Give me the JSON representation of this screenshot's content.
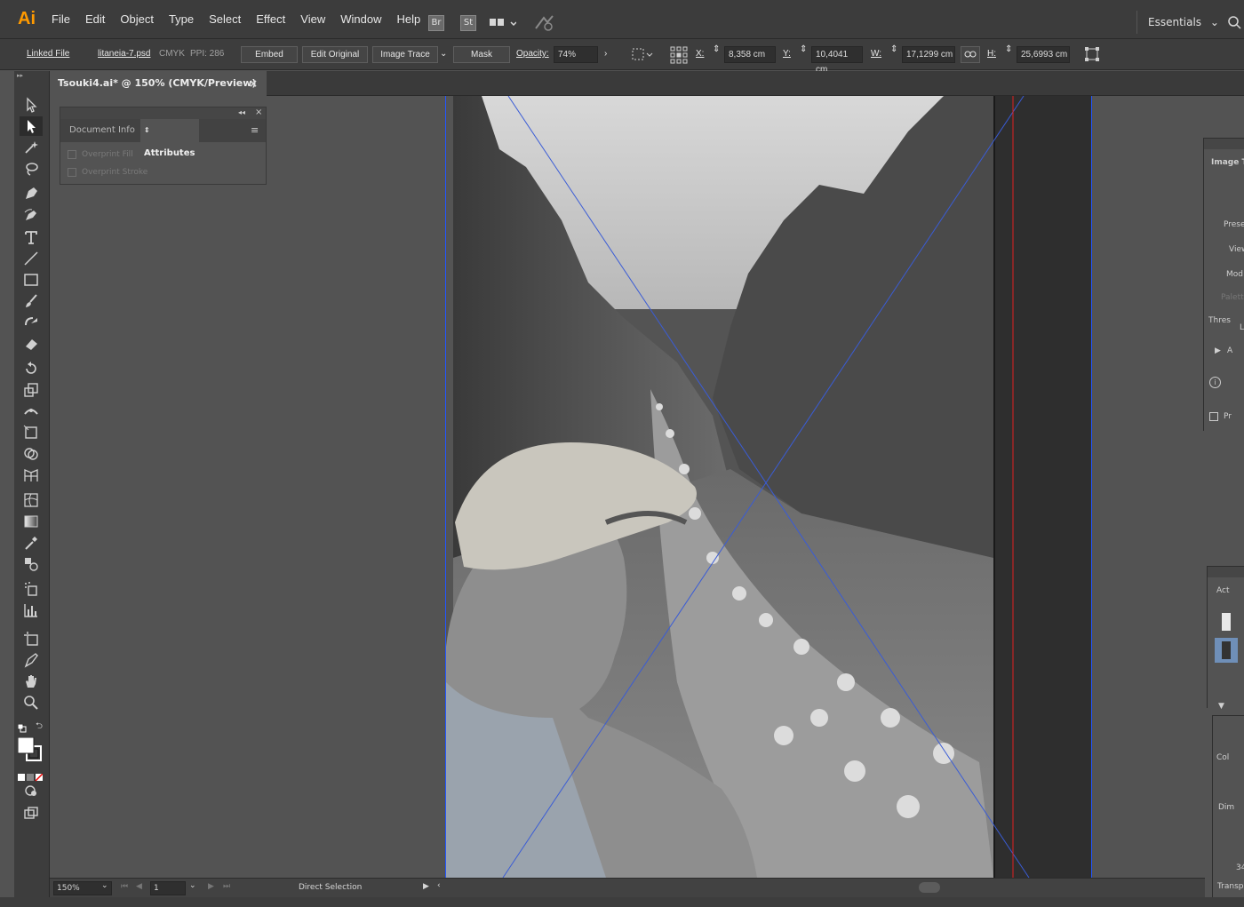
{
  "app": {
    "logo": "Ai",
    "menu": [
      "File",
      "Edit",
      "Object",
      "Type",
      "Select",
      "Effect",
      "View",
      "Window",
      "Help"
    ],
    "bridge_label": "Br",
    "stock_label": "St",
    "workspace": "Essentials"
  },
  "control_bar": {
    "linked_file": "Linked File",
    "file_name": "litaneia-7.psd",
    "color_mode": "CMYK",
    "ppi": "PPI: 286",
    "embed": "Embed",
    "edit_original": "Edit Original",
    "image_trace": "Image Trace",
    "mask": "Mask",
    "opacity_label": "Opacity:",
    "opacity_value": "74%",
    "x_label": "X:",
    "x_value": "8,358 cm",
    "y_label": "Y:",
    "y_value": "10,4041 cm",
    "w_label": "W:",
    "w_value": "17,1299 cm",
    "h_label": "H:",
    "h_value": "25,6993 cm"
  },
  "document_tab": {
    "title": "Tsouki4.ai* @ 150% (CMYK/Preview)",
    "close": "×"
  },
  "attributes_panel": {
    "tab_document_info": "Document Info",
    "tab_attributes": "Attributes",
    "overprint_fill": "Overprint Fill",
    "overprint_stroke": "Overprint Stroke"
  },
  "image_trace_panel": {
    "title": "Image T",
    "preset": "Prese",
    "view": "View",
    "mode": "Mod",
    "palette": "Palett",
    "threshold": "Thres",
    "advanced": "A",
    "preview": "Pr"
  },
  "actions_panel": {
    "title": "Act"
  },
  "transparency_panel": {
    "color": "Col",
    "dimensions": "Dim",
    "value": "34",
    "title": "Transp"
  },
  "status_bar": {
    "zoom": "150%",
    "artboard": "1",
    "tool": "Direct Selection"
  },
  "colors": {
    "accent_logo": "#ff9a00",
    "selection_blue": "#2255ff",
    "guide_red": "#e02020"
  }
}
